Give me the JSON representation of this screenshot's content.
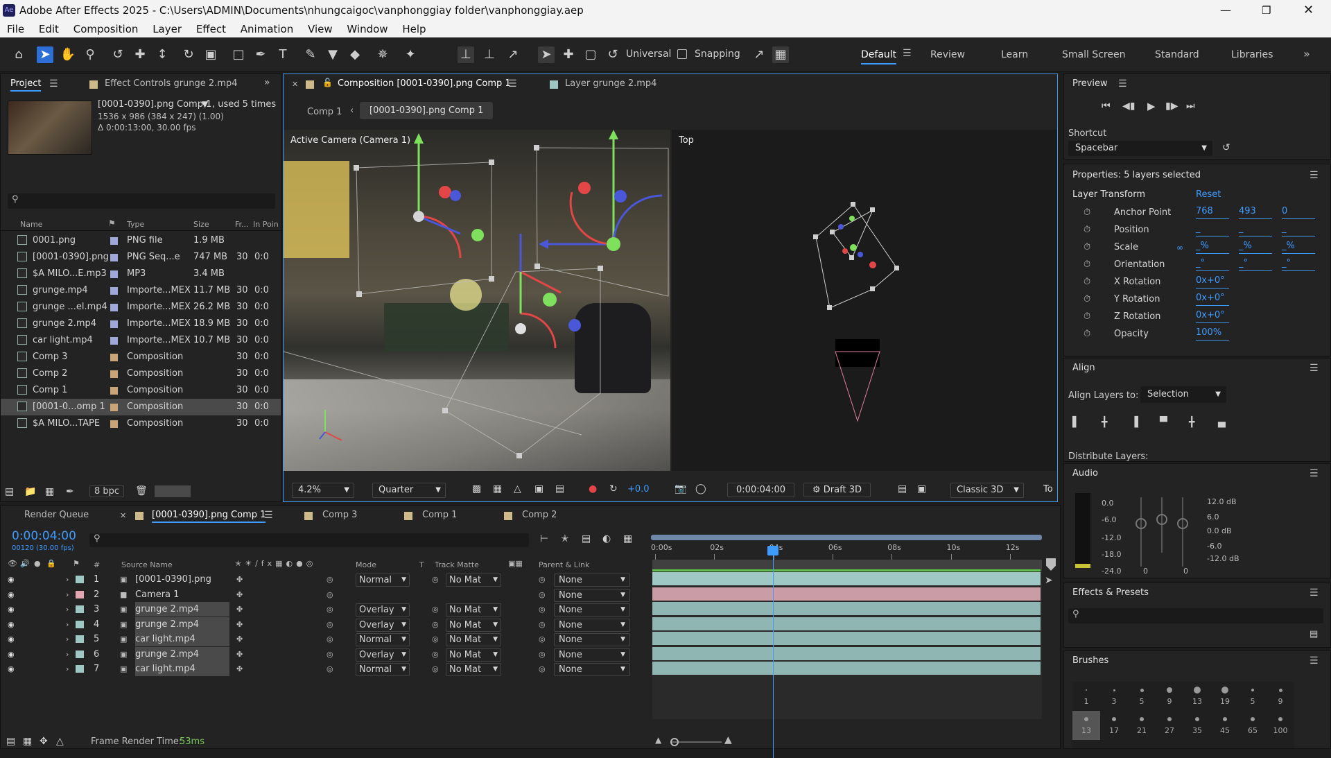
{
  "window": {
    "title": "Adobe After Effects 2025 - C:\\Users\\ADMIN\\Documents\\nhungcaigoc\\vanphonggiay folder\\vanphonggiay.aep"
  },
  "menu": [
    "File",
    "Edit",
    "Composition",
    "Layer",
    "Effect",
    "Animation",
    "View",
    "Window",
    "Help"
  ],
  "toolbar": {
    "universal_label": "Universal",
    "snapping_label": "Snapping",
    "workspaces": [
      "Default",
      "Review",
      "Learn",
      "Small Screen",
      "Standard",
      "Libraries"
    ],
    "active_workspace": "Default"
  },
  "project": {
    "tab": "Project",
    "effect_controls_tab": "Effect Controls grunge 2.mp4",
    "info_name": "[0001-0390].png Comp 1",
    "info_used": ", used 5 times",
    "info_dims": "1536 x 986  (384 x 247) (1.00)",
    "info_duration": "Δ 0:00:13:00, 30.00 fps",
    "columns": [
      "Name",
      "Type",
      "Size",
      "Fr...",
      "In Poin"
    ],
    "items": [
      {
        "name": "0001.png",
        "type": "PNG file",
        "size": "1.9 MB",
        "fr": "",
        "in": "",
        "color": "#9fa8d8",
        "icon": "png-file-icon"
      },
      {
        "name": "[0001-0390].png",
        "type": "PNG Seq...e",
        "size": "747 MB",
        "fr": "30",
        "in": "0:0",
        "color": "#9fa8d8",
        "icon": "png-sequence-icon"
      },
      {
        "name": "$A MILO...E.mp3",
        "type": "MP3",
        "size": "3.4 MB",
        "fr": "",
        "in": "",
        "color": "#9fa8d8",
        "icon": "audio-file-icon"
      },
      {
        "name": "grunge.mp4",
        "type": "Importe...MEX",
        "size": "11.7 MB",
        "fr": "30",
        "in": "0:0",
        "color": "#9fa8d8",
        "icon": "video-file-icon"
      },
      {
        "name": "grunge ...el.mp4",
        "type": "Importe...MEX",
        "size": "26.2 MB",
        "fr": "30",
        "in": "0:0",
        "color": "#9fa8d8",
        "icon": "video-file-icon"
      },
      {
        "name": "grunge 2.mp4",
        "type": "Importe...MEX",
        "size": "18.9 MB",
        "fr": "30",
        "in": "0:0",
        "color": "#9fa8d8",
        "icon": "video-file-icon"
      },
      {
        "name": "car light.mp4",
        "type": "Importe...MEX",
        "size": "10.7 MB",
        "fr": "30",
        "in": "0:0",
        "color": "#9fa8d8",
        "icon": "video-file-icon"
      },
      {
        "name": "Comp 3",
        "type": "Composition",
        "size": "",
        "fr": "30",
        "in": "0:0",
        "color": "#c9a477",
        "icon": "composition-icon"
      },
      {
        "name": "Comp 2",
        "type": "Composition",
        "size": "",
        "fr": "30",
        "in": "0:0",
        "color": "#c9a477",
        "icon": "composition-icon"
      },
      {
        "name": "Comp 1",
        "type": "Composition",
        "size": "",
        "fr": "30",
        "in": "0:0",
        "color": "#c9a477",
        "icon": "composition-icon"
      },
      {
        "name": "[0001-0...omp 1",
        "type": "Composition",
        "size": "",
        "fr": "30",
        "in": "0:0",
        "color": "#c9a477",
        "icon": "composition-icon",
        "selected": true
      },
      {
        "name": "$A MILO...TAPE",
        "type": "Composition",
        "size": "",
        "fr": "30",
        "in": "0:0",
        "color": "#c9a477",
        "icon": "composition-icon"
      }
    ],
    "bpc": "8 bpc"
  },
  "composition": {
    "tab": "Composition [0001-0390].png Comp 1",
    "layer_tab": "Layer grunge 2.mp4",
    "breadcrumb": [
      "Comp 1",
      "[0001-0390].png Comp 1"
    ],
    "active_camera": "Active Camera (Camera 1)",
    "top_view": "Top",
    "zoom": "4.2%",
    "resolution": "Quarter",
    "exposure": "+0.0",
    "timecode": "0:00:04:00",
    "draft3d": "Draft 3D",
    "renderer": "Classic 3D",
    "trailing": "To"
  },
  "preview": {
    "title": "Preview",
    "shortcut_label": "Shortcut",
    "shortcut_value": "Spacebar"
  },
  "properties": {
    "title": "Properties: 5 layers selected",
    "layer_transform": "Layer Transform",
    "reset": "Reset",
    "rows": [
      {
        "label": "Anchor Point",
        "v1": "768",
        "v2": "493",
        "v3": "0"
      },
      {
        "label": "Position",
        "v1": "_",
        "v2": "_",
        "v3": "_"
      },
      {
        "label": "Scale",
        "v1": "_%",
        "v2": "_%",
        "v3": "_%"
      },
      {
        "label": "Orientation",
        "v1": "_°",
        "v2": "_°",
        "v3": "_°"
      },
      {
        "label": "X Rotation",
        "v1": "0x+0°",
        "v2": "",
        "v3": ""
      },
      {
        "label": "Y Rotation",
        "v1": "0x+0°",
        "v2": "",
        "v3": ""
      },
      {
        "label": "Z Rotation",
        "v1": "0x+0°",
        "v2": "",
        "v3": ""
      },
      {
        "label": "Opacity",
        "v1": "100%",
        "v2": "",
        "v3": ""
      }
    ]
  },
  "align": {
    "title": "Align",
    "align_to_label": "Align Layers to:",
    "align_to_value": "Selection",
    "distribute_label": "Distribute Layers:"
  },
  "audio": {
    "title": "Audio",
    "left_scale": [
      "0.0",
      "-6.0",
      "-12.0",
      "-18.0",
      "-24.0"
    ],
    "right_scale": [
      "12.0 dB",
      "6.0",
      "0.0 dB",
      "-6.0",
      "-12.0 dB"
    ],
    "zero_left": "0",
    "zero_right": "0"
  },
  "effects": {
    "title": "Effects & Presets"
  },
  "brushes": {
    "title": "Brushes",
    "row1": [
      "1",
      "3",
      "5",
      "9",
      "13",
      "19",
      "5",
      "9"
    ],
    "row2": [
      "13",
      "17",
      "21",
      "27",
      "35",
      "45",
      "65",
      "100"
    ]
  },
  "timeline": {
    "render_queue_tab": "Render Queue",
    "tabs": [
      "[0001-0390].png Comp 1",
      "Comp 3",
      "Comp 1",
      "Comp 2"
    ],
    "time": "0:00:04:00",
    "frames": "00120 (30.00 fps)",
    "ruler": [
      "0:00s",
      "02s",
      "04s",
      "06s",
      "08s",
      "10s",
      "12s"
    ],
    "cols": {
      "num": "#",
      "source": "Source Name",
      "mode": "Mode",
      "t": "T",
      "track": "Track Matte",
      "parent": "Parent & Link"
    },
    "layers": [
      {
        "num": "1",
        "name": "[0001-0390].png",
        "mode": "Normal",
        "matte": "No Mat",
        "parent": "None",
        "color": "#9fc7c3",
        "bar": "#9fc7c3"
      },
      {
        "num": "2",
        "name": "Camera 1",
        "mode": "",
        "matte": "",
        "parent": "None",
        "color": "#e3a5b1",
        "bar": "#c99ca6"
      },
      {
        "num": "3",
        "name": "grunge 2.mp4",
        "mode": "Overlay",
        "matte": "No Mat",
        "parent": "None",
        "color": "#9fc7c3",
        "bar": "#8fb6b3"
      },
      {
        "num": "4",
        "name": "grunge 2.mp4",
        "mode": "Overlay",
        "matte": "No Mat",
        "parent": "None",
        "color": "#9fc7c3",
        "bar": "#8fb6b3"
      },
      {
        "num": "5",
        "name": "car light.mp4",
        "mode": "Normal",
        "matte": "No Mat",
        "parent": "None",
        "color": "#9fc7c3",
        "bar": "#8fb6b3"
      },
      {
        "num": "6",
        "name": "grunge 2.mp4",
        "mode": "Overlay",
        "matte": "No Mat",
        "parent": "None",
        "color": "#9fc7c3",
        "bar": "#8fb6b3"
      },
      {
        "num": "7",
        "name": "car light.mp4",
        "mode": "Normal",
        "matte": "No Mat",
        "parent": "None",
        "color": "#9fc7c3",
        "bar": "#8fb6b3"
      }
    ],
    "frame_render_label": "Frame Render Time:",
    "frame_render_value": "53ms"
  }
}
